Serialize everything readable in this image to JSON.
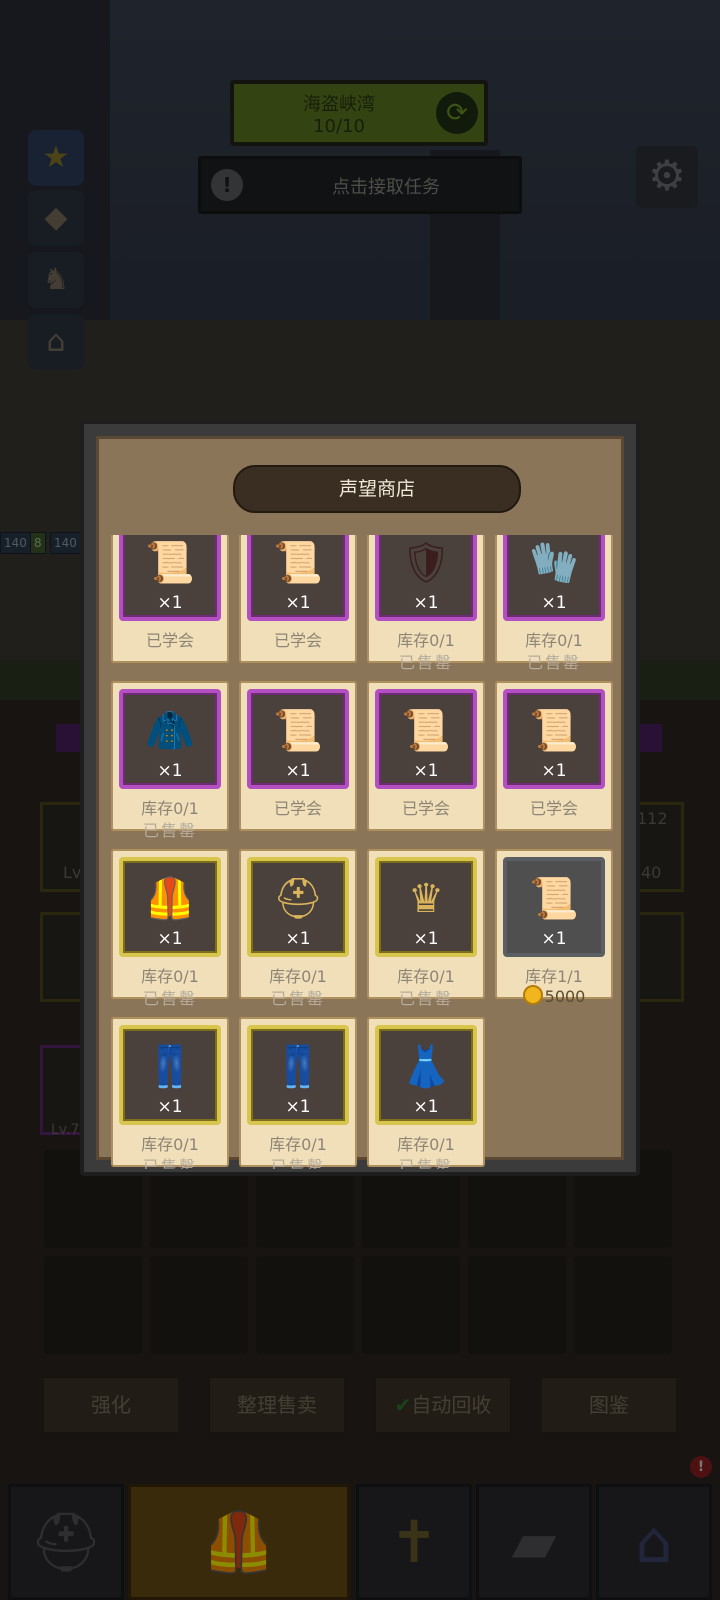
{
  "hud": {
    "dungeon_name": "海盗峡湾",
    "dungeon_progress": "10/10",
    "quest_text": "点击接取任务",
    "hp_left": "140",
    "hp_mid": "8",
    "hp_right": "140",
    "right_slot_top": "112",
    "right_slot_bottom": "40",
    "left_slot_lv": "Lv",
    "left_slot_lv2": "Lv.7"
  },
  "shop": {
    "title": "声望商店",
    "items": [
      {
        "frame": "purple",
        "icon": "scroll-icon",
        "glyph": "📜",
        "qty": "×1",
        "line1": "已学会",
        "line2": ""
      },
      {
        "frame": "purple",
        "icon": "scroll-icon",
        "glyph": "📜",
        "qty": "×1",
        "line1": "已学会",
        "line2": ""
      },
      {
        "frame": "purple",
        "icon": "shoulder-armor-icon",
        "glyph": "🛡",
        "qty": "×1",
        "line1": "库存0/1",
        "line2": "已售罄"
      },
      {
        "frame": "purple",
        "icon": "gauntlet-icon",
        "glyph": "🧤",
        "qty": "×1",
        "line1": "库存0/1",
        "line2": "已售罄"
      },
      {
        "frame": "purple",
        "icon": "cape-icon",
        "glyph": "🧥",
        "qty": "×1",
        "line1": "库存0/1",
        "line2": "已售罄"
      },
      {
        "frame": "purple",
        "icon": "scroll-icon",
        "glyph": "📜",
        "qty": "×1",
        "line1": "已学会",
        "line2": ""
      },
      {
        "frame": "purple",
        "icon": "scroll-icon",
        "glyph": "📜",
        "qty": "×1",
        "line1": "已学会",
        "line2": ""
      },
      {
        "frame": "purple",
        "icon": "scroll-icon",
        "glyph": "📜",
        "qty": "×1",
        "line1": "已学会",
        "line2": ""
      },
      {
        "frame": "gold",
        "icon": "chest-armor-icon",
        "glyph": "🦺",
        "qty": "×1",
        "line1": "库存0/1",
        "line2": "已售罄"
      },
      {
        "frame": "gold",
        "icon": "dark-helmet-icon",
        "glyph": "⛑",
        "qty": "×1",
        "line1": "库存0/1",
        "line2": "已售罄"
      },
      {
        "frame": "gold",
        "icon": "crown-icon",
        "glyph": "♛",
        "qty": "×1",
        "line1": "库存0/1",
        "line2": "已售罄"
      },
      {
        "frame": "gray",
        "icon": "scroll-icon",
        "glyph": "📜",
        "qty": "×1",
        "line1": "库存1/1",
        "line2": "",
        "price": "5000"
      },
      {
        "frame": "gold",
        "icon": "leg-armor-icon",
        "glyph": "👖",
        "qty": "×1",
        "line1": "库存0/1",
        "line2": "已售罄"
      },
      {
        "frame": "gold",
        "icon": "dark-leg-armor-icon",
        "glyph": "👖",
        "qty": "×1",
        "line1": "库存0/1",
        "line2": "已售罄"
      },
      {
        "frame": "gold",
        "icon": "skirt-armor-icon",
        "glyph": "👗",
        "qty": "×1",
        "line1": "库存0/1",
        "line2": "已售罄"
      }
    ]
  },
  "bottom_buttons": {
    "enhance": "强化",
    "sort_sell": "整理售卖",
    "auto_recycle": "自动回收",
    "codex": "图鉴"
  },
  "dock": {
    "badge": "!"
  }
}
